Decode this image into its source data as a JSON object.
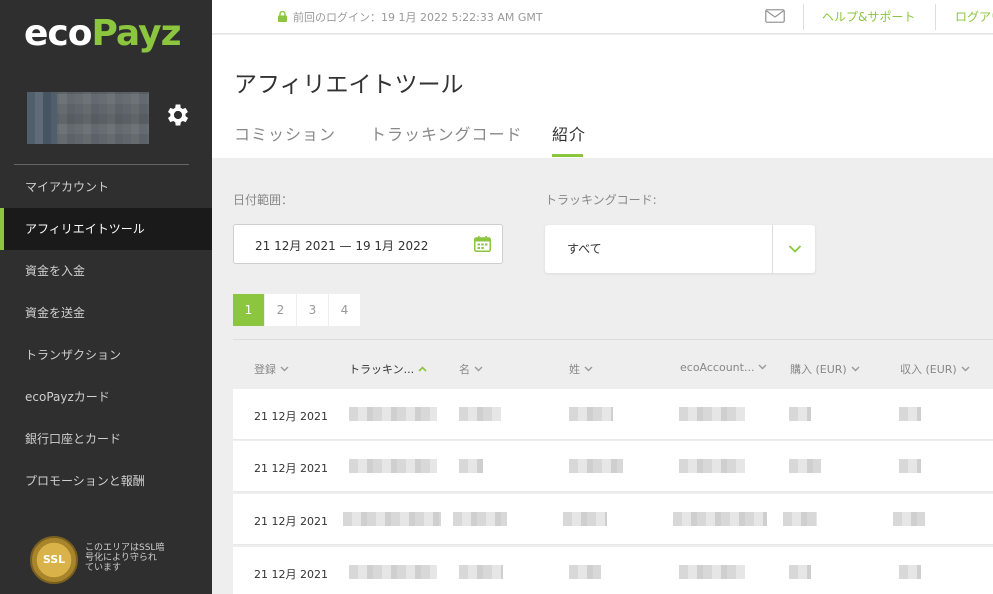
{
  "brand": {
    "eco": "eco",
    "payz": "Payz"
  },
  "topbar": {
    "login_info": "前回のログイン：19 1月 2022 5:22:33 AM GMT",
    "help": "ヘルプ&サポート",
    "logout": "ログアウト"
  },
  "sidebar": {
    "items": [
      {
        "label": "マイアカウント",
        "active": false
      },
      {
        "label": "アフィリエイトツール",
        "active": true
      },
      {
        "label": "資金を入金",
        "active": false
      },
      {
        "label": "資金を送金",
        "active": false
      },
      {
        "label": "トランザクション",
        "active": false
      },
      {
        "label": "ecoPayzカード",
        "active": false
      },
      {
        "label": "銀行口座とカード",
        "active": false
      },
      {
        "label": "プロモーションと報酬",
        "active": false
      }
    ],
    "ssl_badge": "SSL",
    "ssl_text": "このエリアはSSL暗号化により守られています"
  },
  "header": {
    "title": "アフィリエイトツール",
    "tabs": [
      {
        "label": "コミッション",
        "active": false
      },
      {
        "label": "トラッキングコード",
        "active": false
      },
      {
        "label": "紹介",
        "active": true
      }
    ]
  },
  "filters": {
    "date_label": "日付範囲：",
    "date_value": "21 12月 2021 — 19 1月 2022",
    "code_label": "トラッキングコード:",
    "code_value": "すべて"
  },
  "pagination": {
    "pages": [
      "1",
      "2",
      "3",
      "4"
    ],
    "current": "1"
  },
  "table": {
    "columns": [
      "登録",
      "トラッキン...",
      "名",
      "姓",
      "ecoAccount...",
      "購入 (EUR)",
      "収入 (EUR)"
    ],
    "sorted_column": "トラッキン...",
    "rows": [
      {
        "date": "21 12月 2021"
      },
      {
        "date": "21 12月 2021"
      },
      {
        "date": "21 12月 2021"
      },
      {
        "date": "21 12月 2021"
      }
    ]
  },
  "colors": {
    "accent": "#8cc63f",
    "sidebar": "#2f2f2f",
    "sidebar_active": "#1a1a1a"
  },
  "icons": [
    "lock-icon",
    "mail-icon",
    "gear-icon",
    "calendar-icon",
    "chevron-down-icon",
    "sort-caret-icon"
  ]
}
